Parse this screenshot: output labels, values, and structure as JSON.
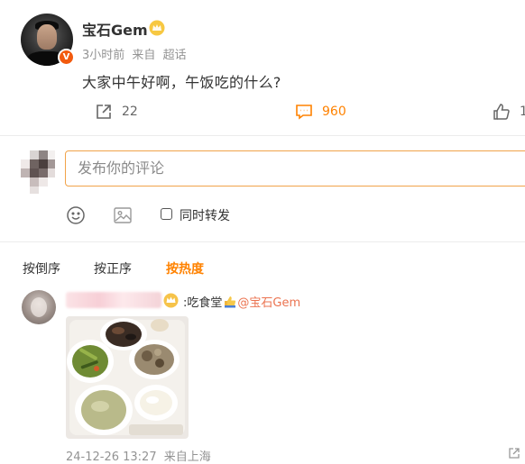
{
  "post": {
    "author_name": "宝石Gem",
    "time": "3小时前",
    "source_prefix": "来自",
    "source": "超话",
    "text": "大家中午好啊，午饭吃的什么?",
    "actions": {
      "repost_count": "22",
      "comment_count": "960",
      "like_count": "1"
    }
  },
  "composer": {
    "placeholder": "发布你的评论",
    "repost_label": "同时转发"
  },
  "sort_tabs": [
    "按倒序",
    "按正序",
    "按热度"
  ],
  "comment": {
    "text_prefix": ":吃食堂",
    "mention": "@宝石Gem",
    "timestamp": "24-12-26 13:27",
    "location": "来自上海"
  },
  "colors": {
    "accent": "#ff8200",
    "mention": "#eb7350",
    "verified": "#f25a0e"
  },
  "icons": {
    "repost": "repost-icon",
    "comment": "comment-icon",
    "like": "thumbs-up-icon",
    "emoji": "smiley-icon",
    "image": "image-icon"
  }
}
